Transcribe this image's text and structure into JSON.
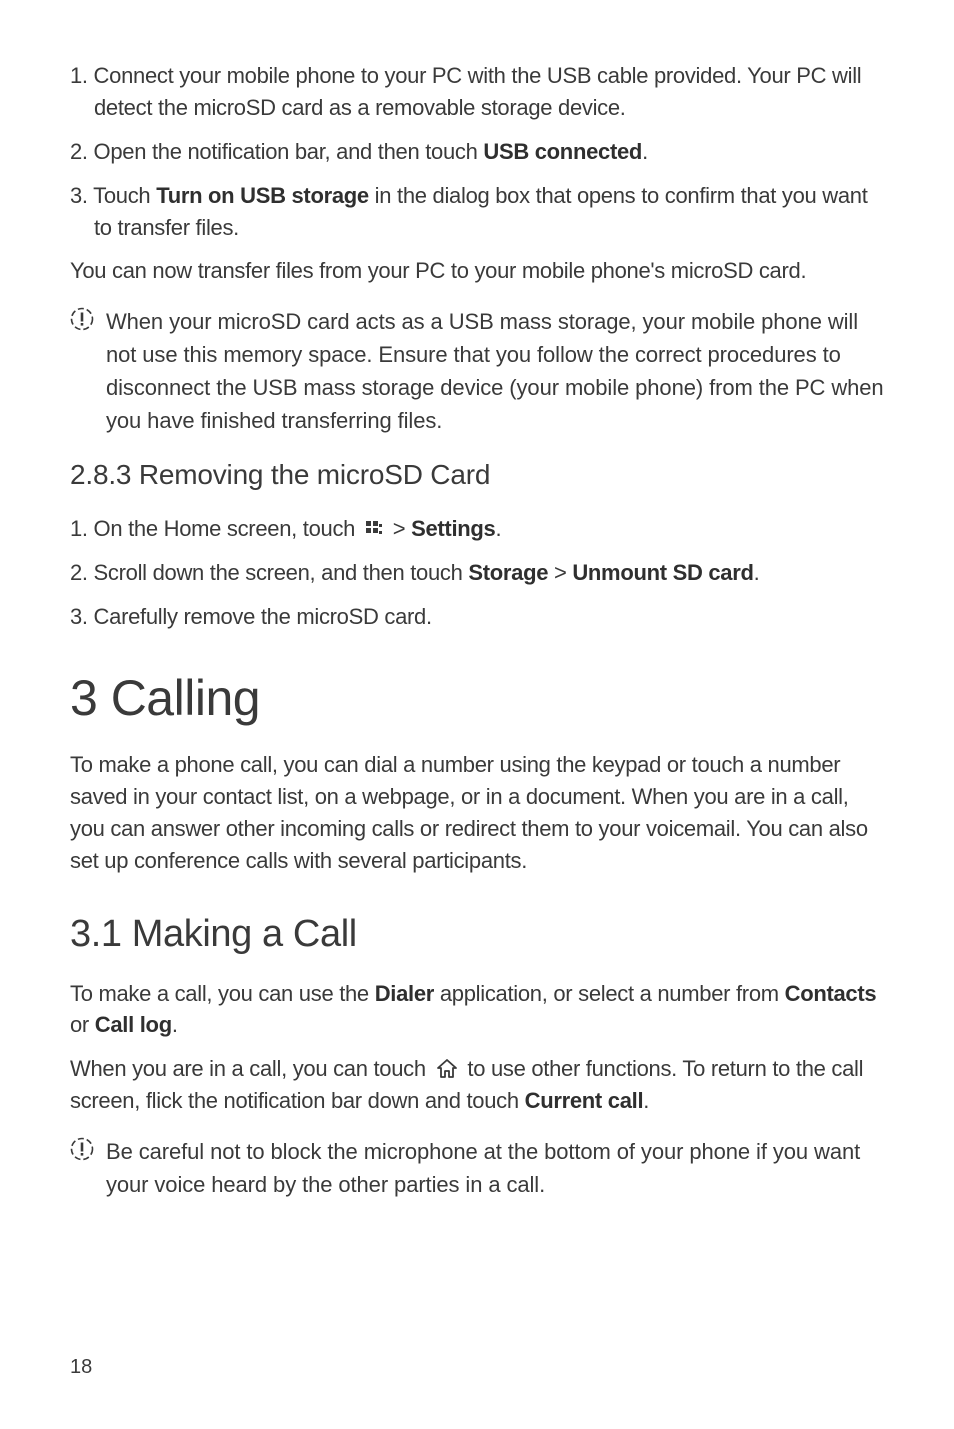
{
  "steps_a": {
    "s1": "1. Connect your mobile phone to your PC with the USB cable provided. Your PC will detect the microSD card as a removable storage device.",
    "s2_pre": "2. Open the notification bar, and then touch ",
    "s2_b": "USB connected",
    "s2_post": ".",
    "s3_pre": "3. Touch ",
    "s3_b": "Turn on USB storage",
    "s3_post": " in the dialog box that opens to confirm that you want to transfer files."
  },
  "para_a": "You can now transfer files from your PC to your mobile phone's microSD card.",
  "note_a": "When your microSD card acts as a USB mass storage, your mobile phone will not use this memory space. Ensure that you follow the correct procedures to disconnect the USB mass storage device (your mobile phone) from the PC when you have finished transferring files.",
  "h3_a": "2.8.3  Removing the microSD Card",
  "steps_b": {
    "s1_pre": "1. On the Home screen, touch ",
    "s1_mid": "  > ",
    "s1_b": "Settings",
    "s1_post": ".",
    "s2_pre": "2. Scroll down the screen, and then touch ",
    "s2_b1": "Storage",
    "s2_mid": " > ",
    "s2_b2": "Unmount SD card",
    "s2_post": ".",
    "s3": "3. Carefully remove the microSD card."
  },
  "h1_a": "3  Calling",
  "para_b": "To make a phone call, you can dial a number using the keypad or touch a number saved in your contact list, on a webpage, or in a document. When you are in a call, you can answer other incoming calls or redirect them to your voicemail. You can also set up conference calls with several participants.",
  "h2_a": "3.1  Making a Call",
  "para_c": {
    "pre": "To make a call, you can use the ",
    "b1": "Dialer",
    "mid1": " application, or select a number from ",
    "b2": "Contacts",
    "mid2": " or ",
    "b3": "Call log",
    "post": "."
  },
  "para_d": {
    "pre": "When you are in a call, you can touch ",
    "mid": "  to use other functions. To return to the call screen, flick the notification bar down and touch ",
    "b": "Current call",
    "post": "."
  },
  "note_b": "Be careful not to block the microphone at the bottom of your phone if you want your voice heard by the other parties in a call.",
  "page_num": "18"
}
